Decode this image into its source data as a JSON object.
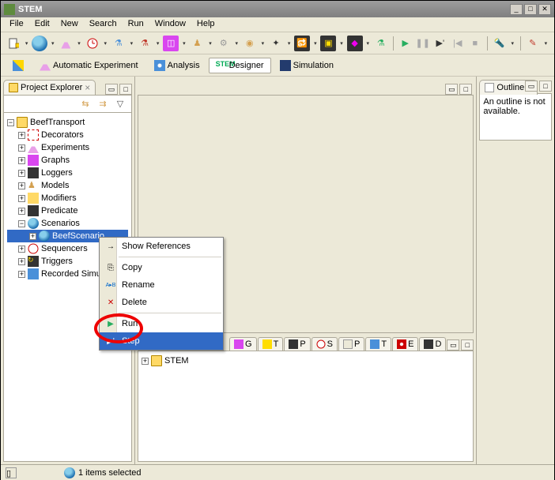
{
  "window": {
    "title": "STEM"
  },
  "menubar": [
    "File",
    "Edit",
    "New",
    "Search",
    "Run",
    "Window",
    "Help"
  ],
  "perspectives": [
    {
      "label": "Automatic Experiment",
      "active": false
    },
    {
      "label": "Analysis",
      "active": false
    },
    {
      "label": "Designer",
      "active": true
    },
    {
      "label": "Simulation",
      "active": false
    }
  ],
  "project_explorer": {
    "title": "Project Explorer",
    "project": "BeefTransport",
    "items": [
      {
        "label": "Decorators"
      },
      {
        "label": "Experiments"
      },
      {
        "label": "Graphs"
      },
      {
        "label": "Loggers"
      },
      {
        "label": "Models"
      },
      {
        "label": "Modifiers"
      },
      {
        "label": "Predicate"
      },
      {
        "label": "Scenarios",
        "expanded": true,
        "children": [
          {
            "label": "BeefScenario",
            "selected": true
          }
        ]
      },
      {
        "label": "Sequencers"
      },
      {
        "label": "Triggers"
      },
      {
        "label": "Recorded Simula"
      }
    ]
  },
  "context_menu": {
    "items": [
      {
        "label": "Show References",
        "icon": "→"
      },
      {
        "label": "Copy",
        "icon": "⎘"
      },
      {
        "label": "Rename",
        "icon": "A▸B"
      },
      {
        "label": "Delete",
        "icon": "✕"
      },
      {
        "label": "Run",
        "icon": "▶"
      },
      {
        "label": "Step",
        "icon": "▶",
        "highlighted": true
      }
    ]
  },
  "bottom_tabs": [
    {
      "label": "G"
    },
    {
      "label": "T"
    },
    {
      "label": "P"
    },
    {
      "label": "S"
    },
    {
      "label": "P"
    },
    {
      "label": "T"
    },
    {
      "label": "E"
    },
    {
      "label": "D"
    }
  ],
  "bottom_tree": {
    "root": "STEM"
  },
  "outline": {
    "title": "Outline",
    "message": "An outline is not available."
  },
  "statusbar": {
    "text": "1 items selected"
  }
}
